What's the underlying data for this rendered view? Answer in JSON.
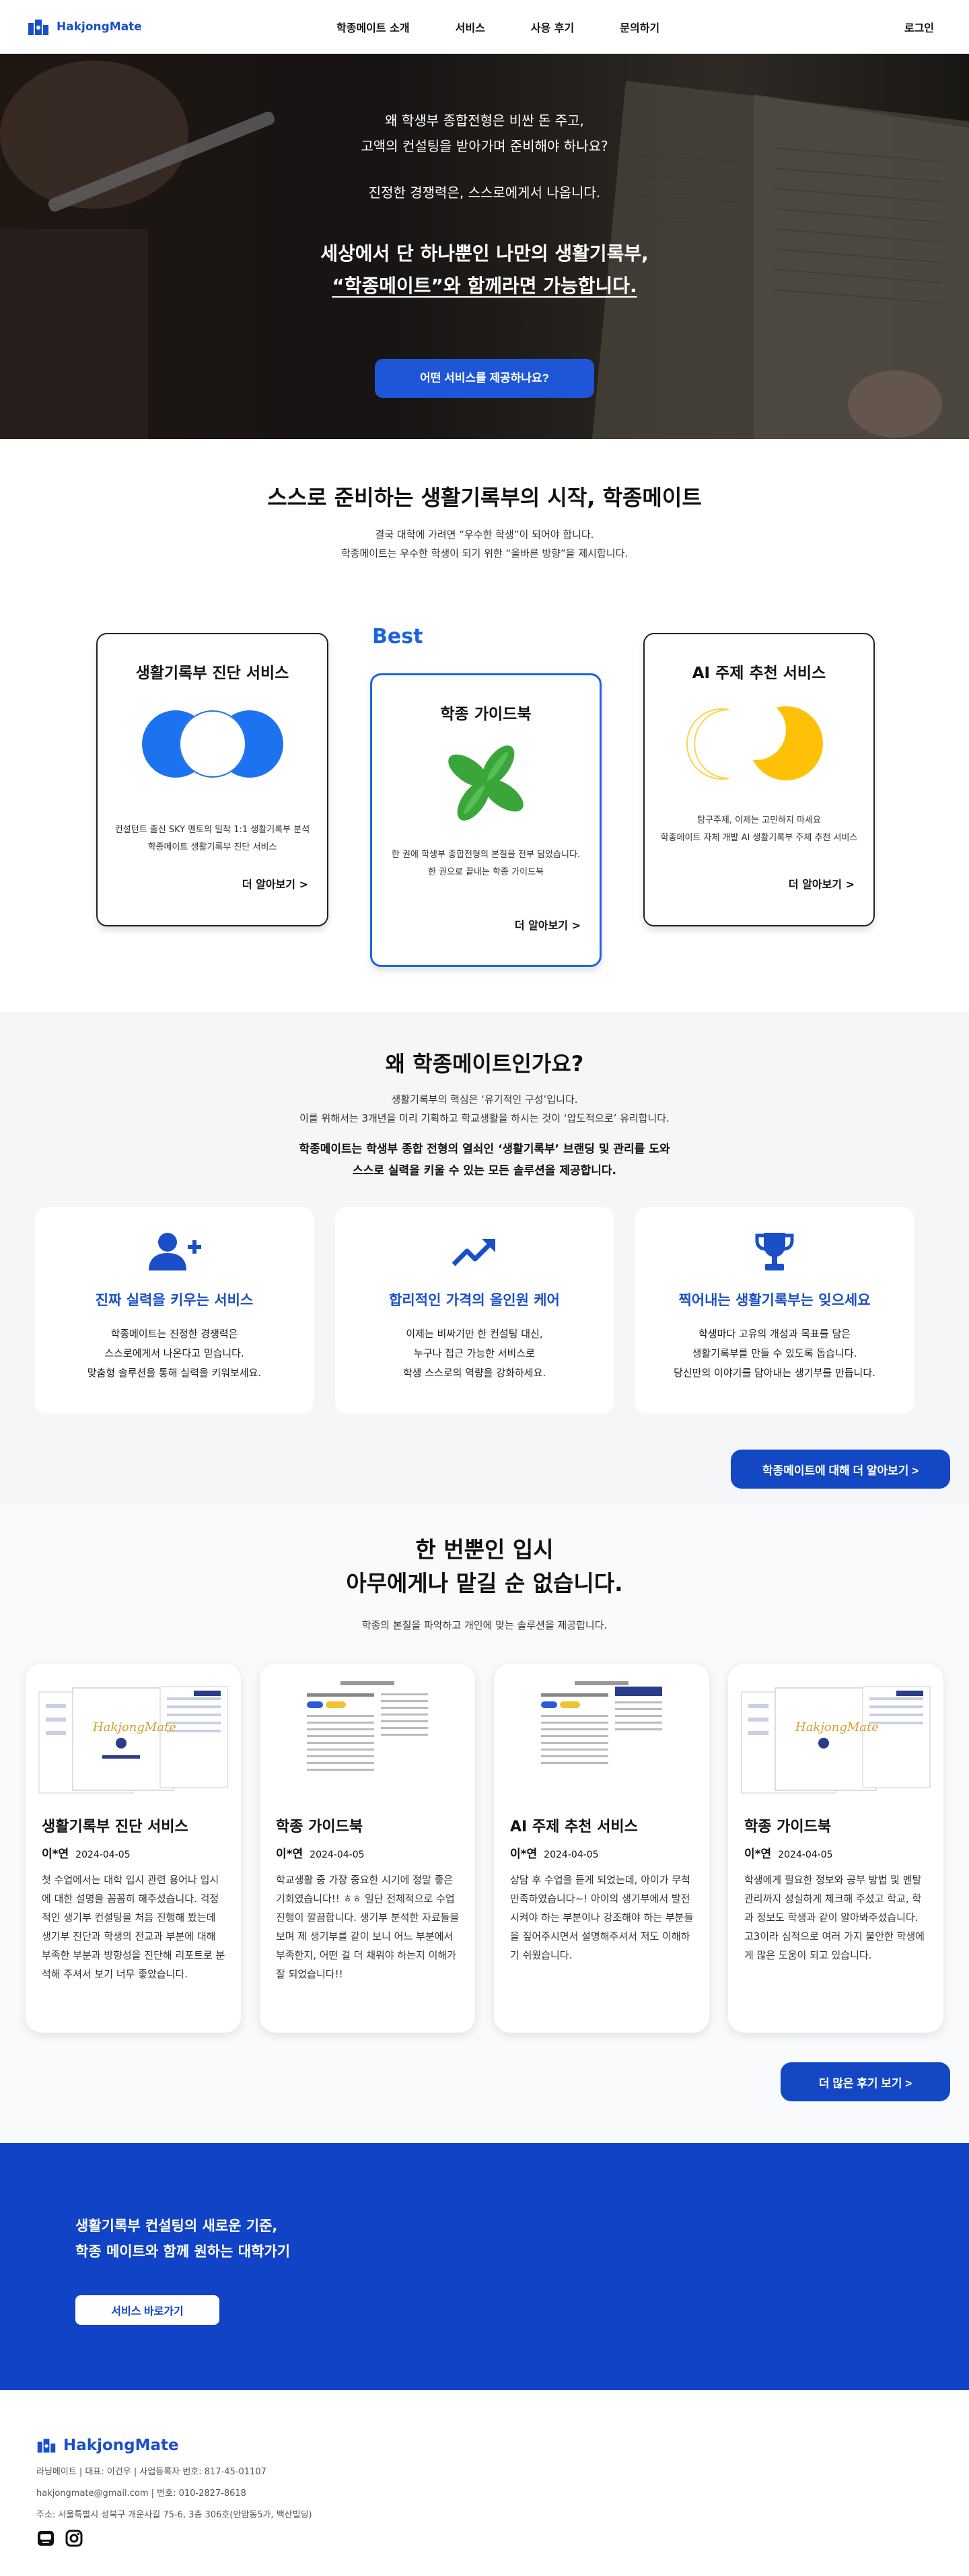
{
  "header": {
    "logo_text": "HakjongMate",
    "nav": [
      "학종메이트 소개",
      "서비스",
      "사용 후기",
      "문의하기"
    ],
    "login": "로그인"
  },
  "hero": {
    "line1": "왜 학생부 종합전형은 비싼 돈 주고,",
    "line2": "고액의 컨설팅을 받아가며 준비해야 하나요?",
    "line3": "진정한 경쟁력은, 스스로에게서 나옵니다.",
    "line4": "세상에서 단 하나뿐인 나만의 생활기록부,",
    "line5": "“학종메이트”와 함께라면 가능합니다.",
    "button": "어떤 서비스를 제공하나요?"
  },
  "services": {
    "title": "스스로 준비하는 생활기록부의 시작, 학종메이트",
    "sub1": "결국 대학에 가려면 “우수한 학생”이 되어야 합니다.",
    "sub2": "학종메이트는 우수한 학생이 되기 위한 “올바른 방향”을 제시합니다.",
    "best_label": "Best",
    "cards": [
      {
        "title": "생활기록부 진단 서비스",
        "desc1": "컨설턴트 출신 SKY 멘토의 밀착 1:1 생활기록부 분석",
        "desc2": "학종메이트 생활기록부 진단 서비스",
        "more": "더 알아보기 >"
      },
      {
        "title": "학종 가이드북",
        "desc1": "한 권에 학생부 종합전형의 본질을 전부 담았습니다.",
        "desc2": "한 권으로 끝내는 학종 가이드북",
        "more": "더 알아보기 >"
      },
      {
        "title": "AI 주제 추천 서비스",
        "desc1": "탐구주제, 이제는 고민하지 마세요",
        "desc2": "학종메이트 자체 개발 AI 생활기록부 주제 추천 서비스",
        "more": "더 알아보기 >"
      }
    ],
    "colors": {
      "blue": "#1d72f0",
      "green": "#3aa63a",
      "yellow": "#ffc107"
    }
  },
  "why": {
    "title": "왜 학종메이트인가요?",
    "sub1": "생활기록부의 핵심은 ‘유기적인 구성’입니다.",
    "sub2": "이를 위해서는 3개년을 미리 기획하고 학교생활을 하시는 것이 ‘압도적으로’ 유리합니다.",
    "bold1": "학종메이트는 학생부 종합 전형의 열쇠인 ‘생활기록부’ 브랜딩 및 관리를 도와",
    "bold2": "스스로 실력을 키울 수 있는 모든 솔루션을 제공합니다.",
    "cards": [
      {
        "icon": "user-plus-icon",
        "title": "진짜 실력을 키우는 서비스",
        "l1": "학종메이트는 진정한 경쟁력은",
        "l2": "스스로에게서 나온다고 믿습니다.",
        "l3": "맞춤형 솔루션을 통해 실력을 키워보세요."
      },
      {
        "icon": "trending-up-icon",
        "title": "합리적인 가격의 올인원 케어",
        "l1": "이제는 비싸기만 한 컨설팅 대신,",
        "l2": "누구나 접근 가능한 서비스로",
        "l3": "학생 스스로의 역량을 강화하세요."
      },
      {
        "icon": "trophy-icon",
        "title": "찍어내는 생활기록부는 잊으세요",
        "l1": "학생마다 고유의 개성과 목표를 담은",
        "l2": "생활기록부를 만들 수 있도록 돕습니다.",
        "l3": "당신만의 이야기를 담아내는 생기부를 만듭니다."
      }
    ],
    "button": "학종메이트에 대해 더 알아보기 >"
  },
  "reviews": {
    "title1": "한 번뿐인 입시",
    "title2": "아무에게나 맡길 순 없습니다.",
    "sub": "학종의 본질을 파악하고 개인에 맞는 솔루션을 제공합니다.",
    "items": [
      {
        "title": "생활기록부 진단 서비스",
        "author": "이*연",
        "date": "2024-04-05",
        "body": "첫 수업에서는 대학 입시 관련 용어나 입시에 대한 설명을 꼼꼼히 해주셨습니다. 걱정적인 생기부 컨설팅을 처음 진행해 봤는데 생기부 진단과 학생의 전교과 부분에 대해 부족한 부분과 방향성을 진단해 리포트로 분석해 주셔서 보기 너무 좋았습니다."
      },
      {
        "title": "학종 가이드북",
        "author": "이*연",
        "date": "2024-04-05",
        "body": "학교생활 중 가장 중요한 시기에 정말 좋은 기회였습니다!! ㅎㅎ 일단 전체적으로 수업 진행이 깔끔합니다. 생기부 분석한 자료들을 보며 제 생기부를 같이 보니 어느 부분에서 부족한지, 어떤 걸 더 채워야 하는지 이해가 잘 되었습니다!!"
      },
      {
        "title": "AI 주제 추천 서비스",
        "author": "이*연",
        "date": "2024-04-05",
        "body": "상담 후 수업을 듣게 되었는데, 아이가 무척 만족하였습니다~! 아이의 생기부에서 발전시켜야 하는 부분이나 강조해야 하는 부분들을 짚어주시면서 설명해주셔서 저도 이해하기 쉬웠습니다."
      },
      {
        "title": "학종 가이드북",
        "author": "이*연",
        "date": "2024-04-05",
        "body": "학생에게 필요한 정보와 공부 방법 및 멘탈 관리까지 성실하게 체크해 주셨고 학교, 학과 정보도 학생과 같이 알아봐주셨습니다. 고3이라 심적으로 여러 가지 불안한 학생에게 많은 도움이 되고 있습니다."
      }
    ],
    "thumb_logo": "HakjongMate",
    "button": "더 많은 후기 보기 >"
  },
  "cta": {
    "line1": "생활기록부 컨설팅의 새로운 기준,",
    "line2": "학종 메이트와 함께 원하는 대학가기",
    "button": "서비스 바로가기"
  },
  "footer": {
    "logo_text": "HakjongMate",
    "line1": "라닝메이트 | 대표: 이건우 | 사업등록자 번호: 817-45-01107",
    "line2": "hakjongmate@gmail.com | 번호: 010-2827-8618",
    "line3": "주소: 서울특별시 성북구 개운사길 75-6, 3층 306호(안암동5가, 백산빌딩)",
    "social_icons": [
      "blog-icon",
      "instagram-icon"
    ]
  }
}
